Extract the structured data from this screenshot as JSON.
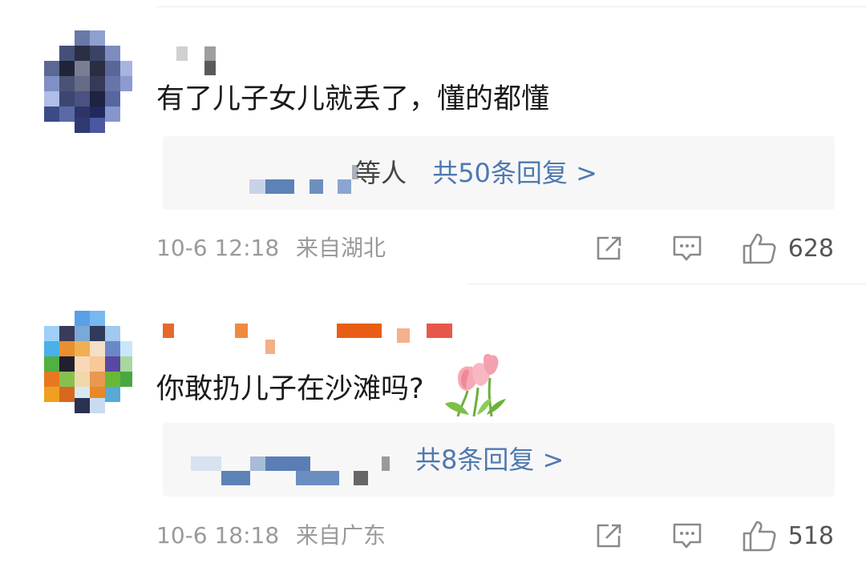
{
  "comments": [
    {
      "text": "有了儿子女儿就丢了，懂的都懂",
      "reply_people_suffix": "等人",
      "reply_link": "共50条回复 >",
      "time": "10-6 12:18",
      "location": "来自湖北",
      "likes": "628",
      "icons": {
        "share": "share-icon",
        "comment": "comment-icon",
        "like": "thumbs-up-icon"
      }
    },
    {
      "text": "你敢扔儿子在沙滩吗?",
      "reply_link": "共8条回复 >",
      "time": "10-6 18:18",
      "location": "来自广东",
      "likes": "518",
      "icons": {
        "share": "share-icon",
        "comment": "comment-icon",
        "like": "thumbs-up-icon",
        "emoji": "tulip-emoji-icon"
      }
    }
  ],
  "colors": {
    "link": "#4e79b0",
    "meta": "#9a9a9a",
    "reply_bg": "#f7f7f8",
    "text": "#1a1a1a"
  }
}
